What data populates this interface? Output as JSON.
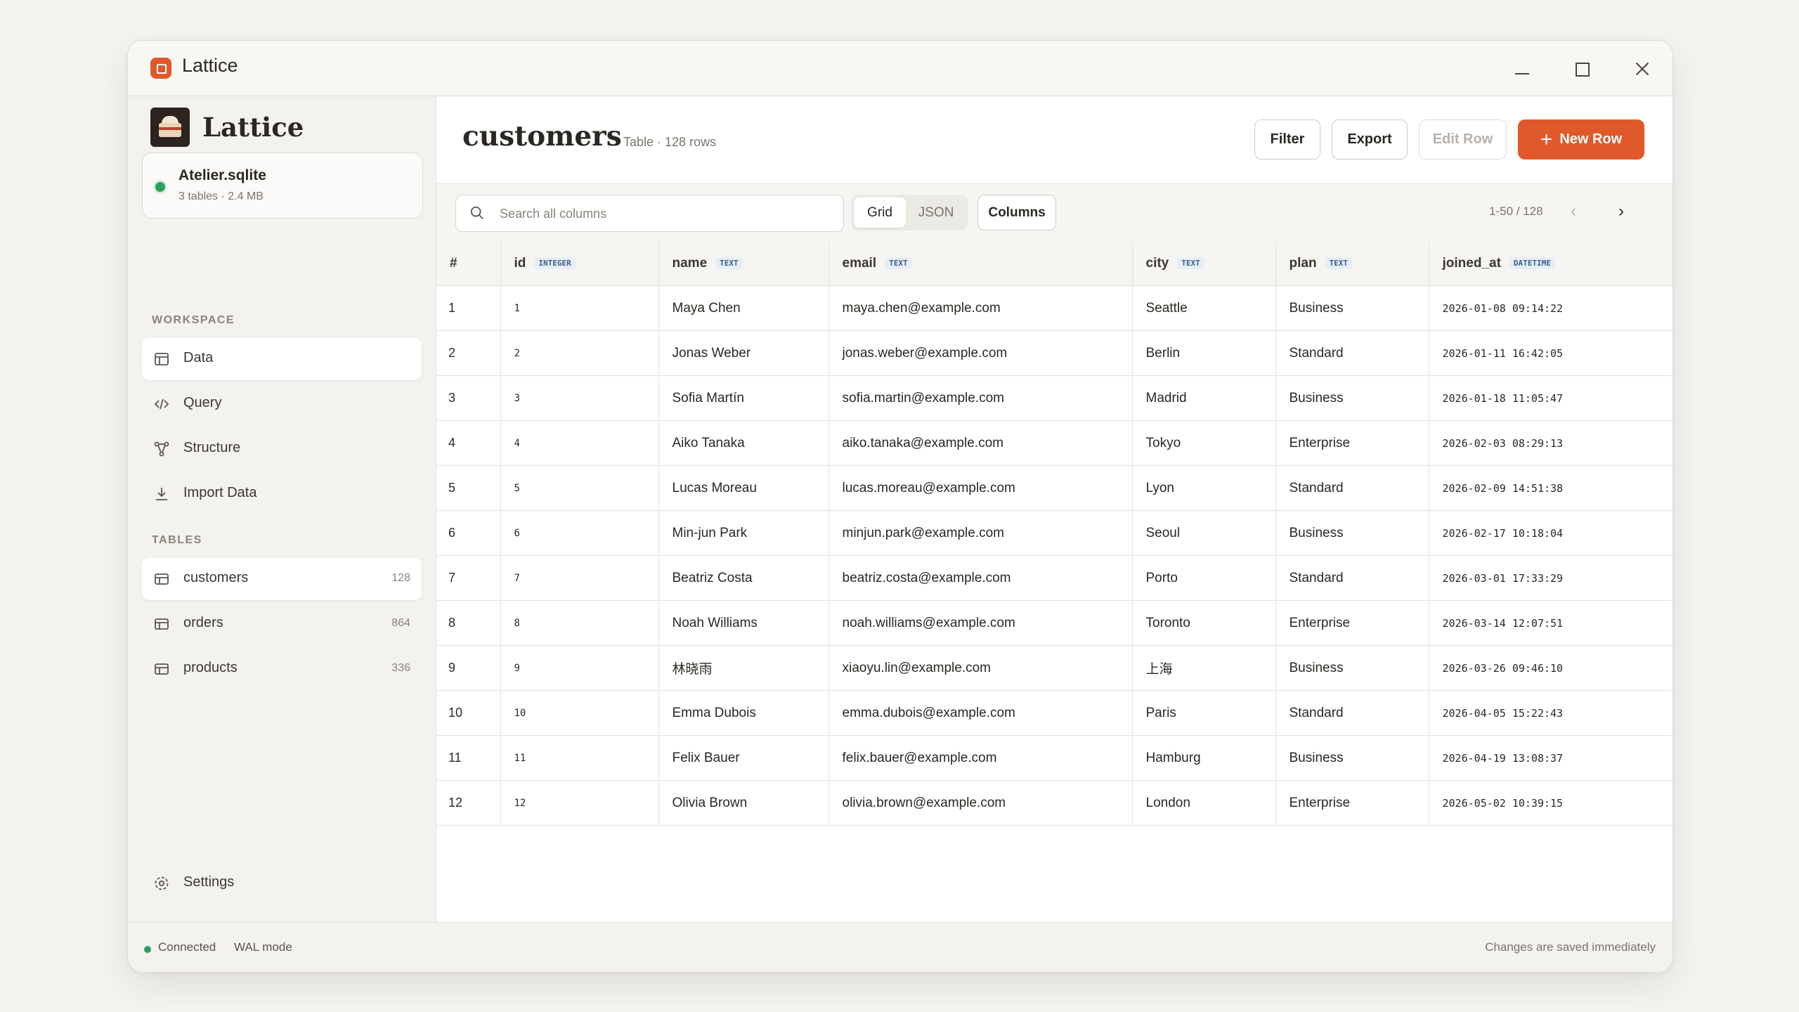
{
  "window": {
    "title": "Lattice"
  },
  "sidebar": {
    "brand": "Lattice",
    "database": {
      "name": "Atelier.sqlite",
      "meta": "3 tables · 2.4 MB",
      "status_color": "#2e9e5b"
    },
    "workspace_label": "WORKSPACE",
    "workspace_items": [
      {
        "label": "Data",
        "icon": "table-icon",
        "active": true
      },
      {
        "label": "Query",
        "icon": "code-icon"
      },
      {
        "label": "Structure",
        "icon": "schema-icon"
      },
      {
        "label": "Import Data",
        "icon": "download-icon"
      }
    ],
    "tables_label": "TABLES",
    "tables": [
      {
        "label": "customers",
        "count": "128",
        "active": true
      },
      {
        "label": "orders",
        "count": "864"
      },
      {
        "label": "products",
        "count": "336"
      }
    ],
    "settings_label": "Settings"
  },
  "header": {
    "title": "customers",
    "subtitle": "Table · 128 rows",
    "filter_label": "Filter",
    "export_label": "Export",
    "edit_label": "Edit Row",
    "new_label": "New Row",
    "accent": "#e0592b"
  },
  "toolbar": {
    "search_placeholder": "Search all columns",
    "view_grid": "Grid",
    "view_json": "JSON",
    "columns_label": "Columns",
    "pager": "1-50 / 128"
  },
  "table": {
    "columns": [
      {
        "name": "#",
        "type": ""
      },
      {
        "name": "id",
        "type": "INTEGER"
      },
      {
        "name": "name",
        "type": "TEXT"
      },
      {
        "name": "email",
        "type": "TEXT"
      },
      {
        "name": "city",
        "type": "TEXT"
      },
      {
        "name": "plan",
        "type": "TEXT"
      },
      {
        "name": "joined_at",
        "type": "DATETIME"
      }
    ],
    "rows": [
      [
        "1",
        "1",
        "Maya Chen",
        "maya.chen@example.com",
        "Seattle",
        "Business",
        "2026-01-08 09:14:22"
      ],
      [
        "2",
        "2",
        "Jonas Weber",
        "jonas.weber@example.com",
        "Berlin",
        "Standard",
        "2026-01-11 16:42:05"
      ],
      [
        "3",
        "3",
        "Sofia Martín",
        "sofia.martin@example.com",
        "Madrid",
        "Business",
        "2026-01-18 11:05:47"
      ],
      [
        "4",
        "4",
        "Aiko Tanaka",
        "aiko.tanaka@example.com",
        "Tokyo",
        "Enterprise",
        "2026-02-03 08:29:13"
      ],
      [
        "5",
        "5",
        "Lucas Moreau",
        "lucas.moreau@example.com",
        "Lyon",
        "Standard",
        "2026-02-09 14:51:38"
      ],
      [
        "6",
        "6",
        "Min-jun Park",
        "minjun.park@example.com",
        "Seoul",
        "Business",
        "2026-02-17 10:18:04"
      ],
      [
        "7",
        "7",
        "Beatriz Costa",
        "beatriz.costa@example.com",
        "Porto",
        "Standard",
        "2026-03-01 17:33:29"
      ],
      [
        "8",
        "8",
        "Noah Williams",
        "noah.williams@example.com",
        "Toronto",
        "Enterprise",
        "2026-03-14 12:07:51"
      ],
      [
        "9",
        "9",
        "林晓雨",
        "xiaoyu.lin@example.com",
        "上海",
        "Business",
        "2026-03-26 09:46:10"
      ],
      [
        "10",
        "10",
        "Emma Dubois",
        "emma.dubois@example.com",
        "Paris",
        "Standard",
        "2026-04-05 15:22:43"
      ],
      [
        "11",
        "11",
        "Felix Bauer",
        "felix.bauer@example.com",
        "Hamburg",
        "Business",
        "2026-04-19 13:08:37"
      ],
      [
        "12",
        "12",
        "Olivia Brown",
        "olivia.brown@example.com",
        "London",
        "Enterprise",
        "2026-05-02 10:39:15"
      ]
    ]
  },
  "statusbar": {
    "connected": "Connected",
    "mode": "WAL mode",
    "saved": "Changes are saved immediately"
  }
}
